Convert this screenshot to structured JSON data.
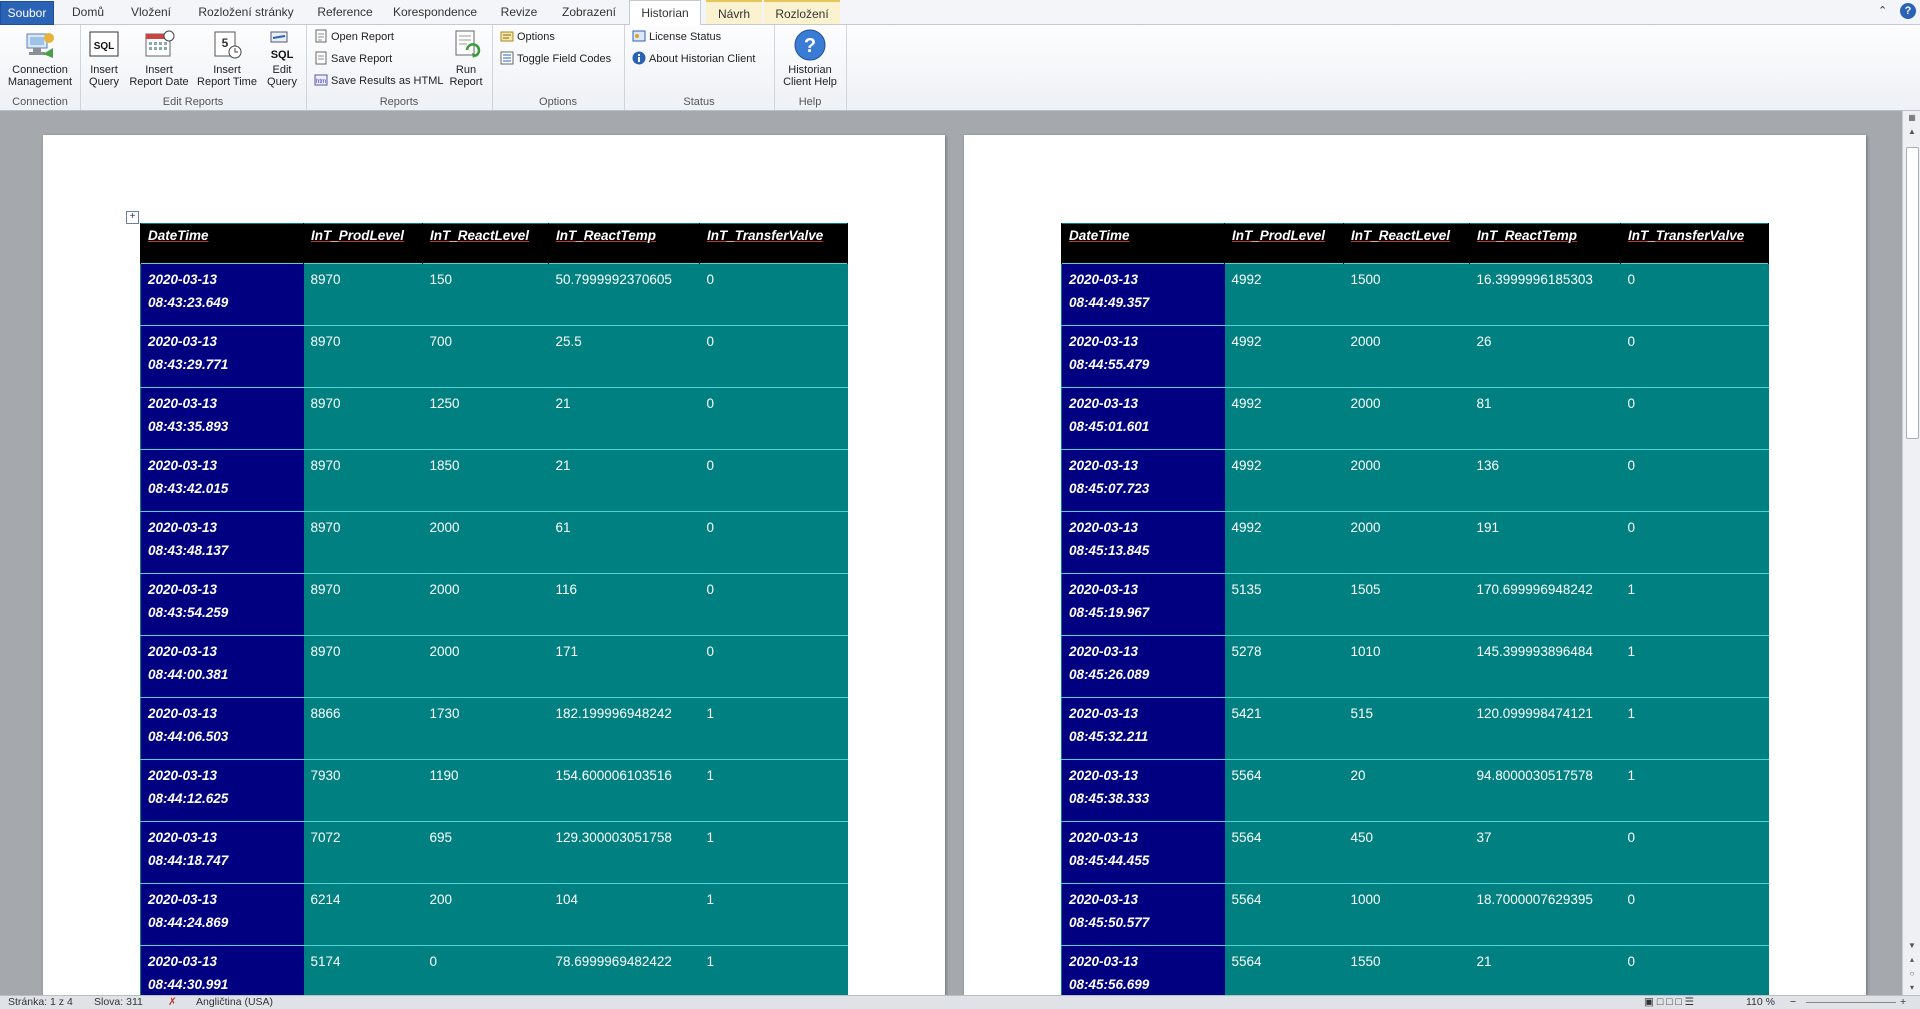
{
  "tabs": [
    {
      "label": "Soubor",
      "kind": "file"
    },
    {
      "label": "Domů"
    },
    {
      "label": "Vložení"
    },
    {
      "label": "Rozložení stránky"
    },
    {
      "label": "Reference"
    },
    {
      "label": "Korespondence"
    },
    {
      "label": "Revize"
    },
    {
      "label": "Zobrazení"
    },
    {
      "label": "Historian",
      "active": true
    },
    {
      "label": "Návrh",
      "contextual": true
    },
    {
      "label": "Rozložení",
      "contextual": true
    }
  ],
  "ribbon": {
    "connection": {
      "group": "Connection",
      "btn1": "Connection",
      "btn2": "Management"
    },
    "edit_reports": {
      "group": "Edit Reports",
      "insert_query": [
        "Insert",
        "Query"
      ],
      "insert_report_date": [
        "Insert",
        "Report Date"
      ],
      "insert_report_time": [
        "Insert",
        "Report Time"
      ],
      "edit_query": [
        "Edit",
        "Query"
      ]
    },
    "reports": {
      "group": "Reports",
      "open_report": "Open Report",
      "save_report": "Save Report",
      "save_html": "Save Results as HTML",
      "run_report": [
        "Run",
        "Report"
      ]
    },
    "options": {
      "group": "Options",
      "options": "Options",
      "toggle": "Toggle Field Codes"
    },
    "status": {
      "group": "Status",
      "license": "License Status",
      "about": "About Historian Client"
    },
    "help": {
      "group": "Help",
      "btn": [
        "Historian",
        "Client Help"
      ]
    }
  },
  "table_headers": [
    "DateTime",
    "InT_ProdLevel",
    "InT_ReactLevel",
    "InT_ReactTemp",
    "InT_TransferValve"
  ],
  "page1_rows": [
    {
      "date": "2020-03-13",
      "time": "08:43:23.649",
      "prod": "8970",
      "react": "150",
      "temp": "50.7999992370605",
      "valve": "0"
    },
    {
      "date": "2020-03-13",
      "time": "08:43:29.771",
      "prod": "8970",
      "react": "700",
      "temp": "25.5",
      "valve": "0"
    },
    {
      "date": "2020-03-13",
      "time": "08:43:35.893",
      "prod": "8970",
      "react": "1250",
      "temp": "21",
      "valve": "0"
    },
    {
      "date": "2020-03-13",
      "time": "08:43:42.015",
      "prod": "8970",
      "react": "1850",
      "temp": "21",
      "valve": "0"
    },
    {
      "date": "2020-03-13",
      "time": "08:43:48.137",
      "prod": "8970",
      "react": "2000",
      "temp": "61",
      "valve": "0"
    },
    {
      "date": "2020-03-13",
      "time": "08:43:54.259",
      "prod": "8970",
      "react": "2000",
      "temp": "116",
      "valve": "0"
    },
    {
      "date": "2020-03-13",
      "time": "08:44:00.381",
      "prod": "8970",
      "react": "2000",
      "temp": "171",
      "valve": "0"
    },
    {
      "date": "2020-03-13",
      "time": "08:44:06.503",
      "prod": "8866",
      "react": "1730",
      "temp": "182.199996948242",
      "valve": "1"
    },
    {
      "date": "2020-03-13",
      "time": "08:44:12.625",
      "prod": "7930",
      "react": "1190",
      "temp": "154.600006103516",
      "valve": "1"
    },
    {
      "date": "2020-03-13",
      "time": "08:44:18.747",
      "prod": "7072",
      "react": "695",
      "temp": "129.300003051758",
      "valve": "1"
    },
    {
      "date": "2020-03-13",
      "time": "08:44:24.869",
      "prod": "6214",
      "react": "200",
      "temp": "104",
      "valve": "1"
    },
    {
      "date": "2020-03-13",
      "time": "08:44:30.991",
      "prod": "5174",
      "react": "0",
      "temp": "78.6999969482422",
      "valve": "1"
    }
  ],
  "page2_rows": [
    {
      "date": "2020-03-13",
      "time": "08:44:49.357",
      "prod": "4992",
      "react": "1500",
      "temp": "16.3999996185303",
      "valve": "0"
    },
    {
      "date": "2020-03-13",
      "time": "08:44:55.479",
      "prod": "4992",
      "react": "2000",
      "temp": "26",
      "valve": "0"
    },
    {
      "date": "2020-03-13",
      "time": "08:45:01.601",
      "prod": "4992",
      "react": "2000",
      "temp": "81",
      "valve": "0"
    },
    {
      "date": "2020-03-13",
      "time": "08:45:07.723",
      "prod": "4992",
      "react": "2000",
      "temp": "136",
      "valve": "0"
    },
    {
      "date": "2020-03-13",
      "time": "08:45:13.845",
      "prod": "4992",
      "react": "2000",
      "temp": "191",
      "valve": "0"
    },
    {
      "date": "2020-03-13",
      "time": "08:45:19.967",
      "prod": "5135",
      "react": "1505",
      "temp": "170.699996948242",
      "valve": "1"
    },
    {
      "date": "2020-03-13",
      "time": "08:45:26.089",
      "prod": "5278",
      "react": "1010",
      "temp": "145.399993896484",
      "valve": "1"
    },
    {
      "date": "2020-03-13",
      "time": "08:45:32.211",
      "prod": "5421",
      "react": "515",
      "temp": "120.099998474121",
      "valve": "1"
    },
    {
      "date": "2020-03-13",
      "time": "08:45:38.333",
      "prod": "5564",
      "react": "20",
      "temp": "94.8000030517578",
      "valve": "1"
    },
    {
      "date": "2020-03-13",
      "time": "08:45:44.455",
      "prod": "5564",
      "react": "450",
      "temp": "37",
      "valve": "0"
    },
    {
      "date": "2020-03-13",
      "time": "08:45:50.577",
      "prod": "5564",
      "react": "1000",
      "temp": "18.7000007629395",
      "valve": "0"
    },
    {
      "date": "2020-03-13",
      "time": "08:45:56.699",
      "prod": "5564",
      "react": "1550",
      "temp": "21",
      "valve": "0"
    }
  ],
  "status": {
    "page": "Stránka: 1 z 4",
    "words": "Slova: 311",
    "language": "Angličtina (USA)",
    "zoom": "110 %"
  }
}
